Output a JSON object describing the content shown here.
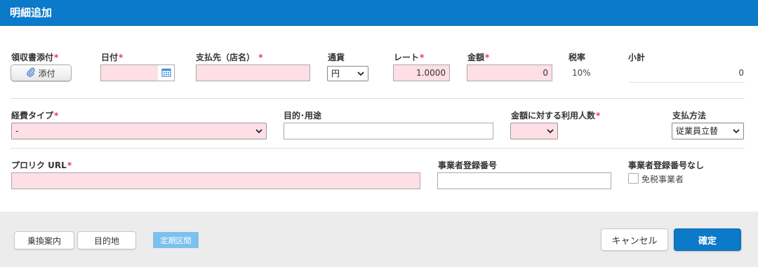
{
  "dialog": {
    "title": "明細追加"
  },
  "colors": {
    "accent": "#0a7ac9",
    "required": "#e8336b",
    "required_field_bg": "#ffdfe6",
    "footer_bg": "#ececec"
  },
  "row1": {
    "receipt": {
      "label": "領収書添付",
      "button": "添付",
      "icon": "paperclip-icon"
    },
    "date": {
      "label": "日付",
      "value": "",
      "icon": "calendar-icon"
    },
    "payee": {
      "label": "支払先（店名）",
      "value": ""
    },
    "currency": {
      "label": "通貨",
      "selected": "円"
    },
    "rate": {
      "label": "レート",
      "value": "1.0000"
    },
    "amount": {
      "label": "金額",
      "value": "0"
    },
    "tax": {
      "label": "税率",
      "value": "10%"
    },
    "subtotal": {
      "label": "小計",
      "value": "0"
    }
  },
  "row2": {
    "expense_type": {
      "label": "経費タイプ",
      "selected": "-"
    },
    "purpose": {
      "label": "目的･用途",
      "value": ""
    },
    "people": {
      "label": "金額に対する利用人数",
      "selected": ""
    },
    "payment": {
      "label": "支払方法",
      "selected": "従業員立替"
    }
  },
  "row3": {
    "url": {
      "label": "プロリク URL",
      "value": ""
    },
    "reg_no": {
      "label": "事業者登録番号",
      "value": ""
    },
    "no_reg": {
      "label": "事業者登録番号なし",
      "checkbox_label": "免税事業者",
      "checked": false
    }
  },
  "footer": {
    "transfer": "乗換案内",
    "destination": "目的地",
    "commuter_tag": "定期区間",
    "cancel": "キャンセル",
    "confirm": "確定"
  }
}
